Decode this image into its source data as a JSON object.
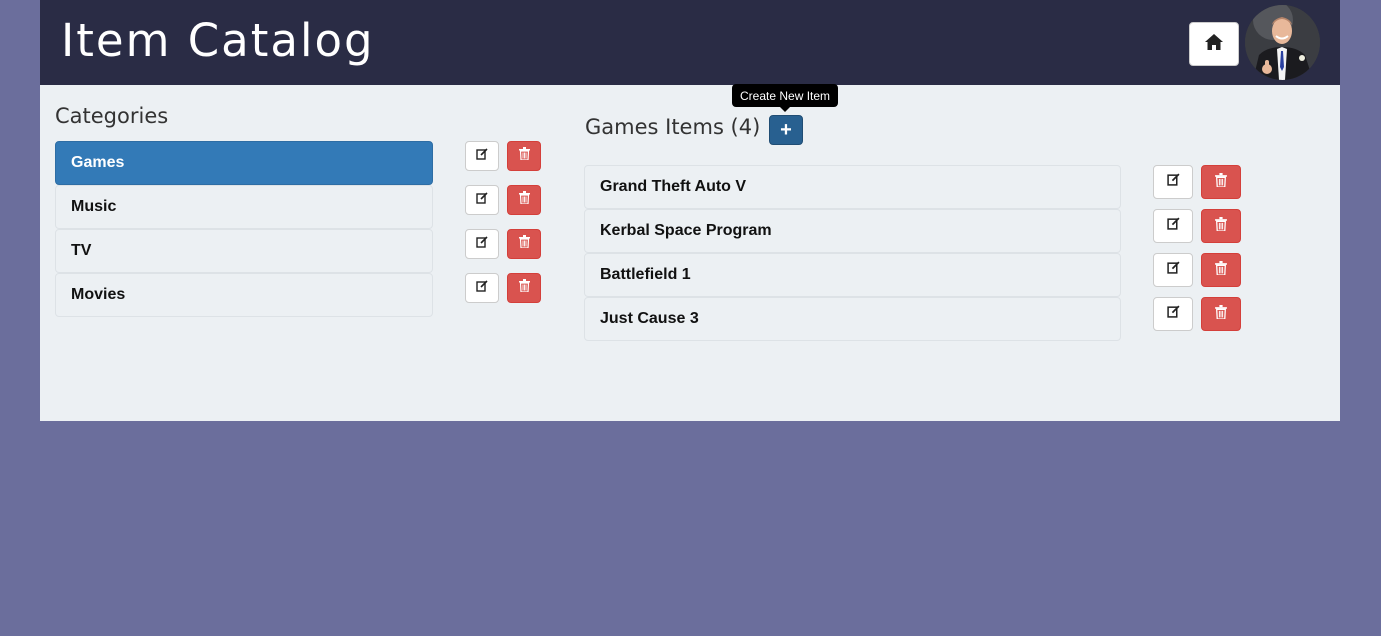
{
  "header": {
    "title": "Item Catalog",
    "home_icon": "home-icon",
    "avatar_icon": "user-avatar"
  },
  "categories": {
    "title": "Categories",
    "items": [
      {
        "label": "Games",
        "active": true
      },
      {
        "label": "Music",
        "active": false
      },
      {
        "label": "TV",
        "active": false
      },
      {
        "label": "Movies",
        "active": false
      }
    ],
    "edit_icon": "edit-icon",
    "delete_icon": "trash-icon"
  },
  "items_panel": {
    "title": "Games Items (4)",
    "add_label": "+",
    "tooltip": "Create New Item",
    "items": [
      {
        "label": "Grand Theft Auto V"
      },
      {
        "label": "Kerbal Space Program"
      },
      {
        "label": "Battlefield 1"
      },
      {
        "label": "Just Cause 3"
      }
    ]
  },
  "colors": {
    "header_bg": "#2a2c45",
    "page_bg": "#6b6e9c",
    "panel_bg": "#ecf0f3",
    "active_blue": "#337ab7",
    "add_blue": "#286090",
    "danger_red": "#d9534f"
  }
}
